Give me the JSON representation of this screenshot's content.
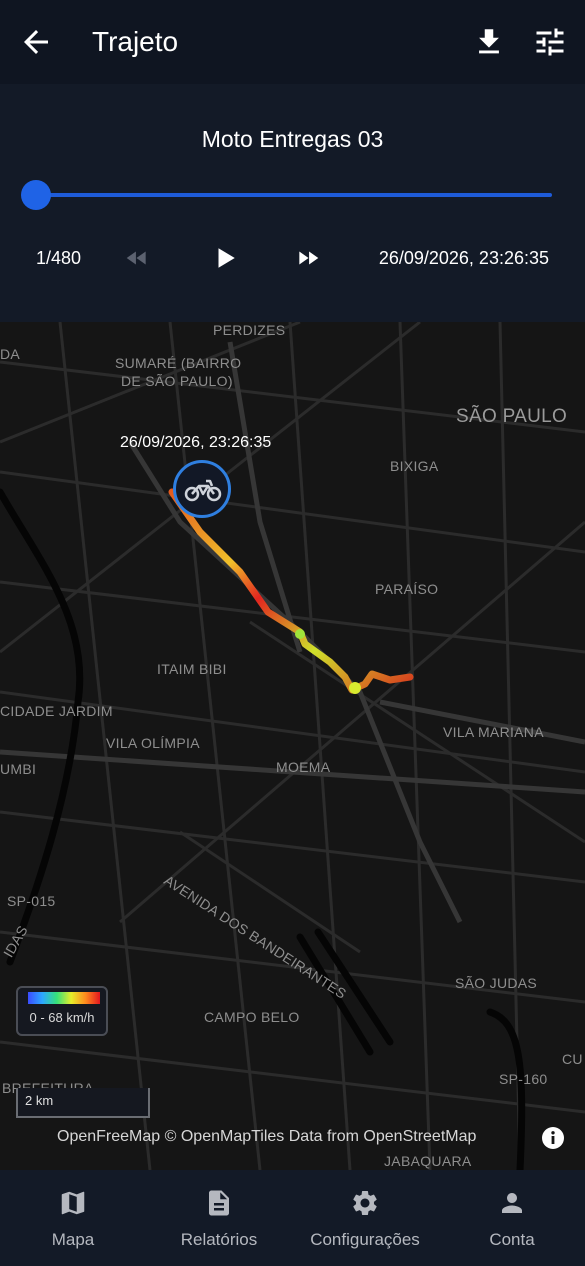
{
  "appbar": {
    "title": "Trajeto"
  },
  "player": {
    "device_name": "Moto Entregas 03",
    "counter": "1/480",
    "timestamp": "26/09/2026, 23:26:35",
    "progress": 0.0
  },
  "map": {
    "labels": {
      "perdizes": "PERDIZES",
      "da": "DA",
      "sumare1": "SUMARÉ (BAIRRO",
      "sumare2": "DE SÃO PAULO)",
      "sao_paulo": "SÃO PAULO",
      "bixiga": "BIXIGA",
      "paraiso": "PARAÍSO",
      "itaim": "ITAIM BIBI",
      "cidade_jardim": "CIDADE JARDIM",
      "vila_olimpia": "VILA OLÍMPIA",
      "vila_mariana": "VILA MARIANA",
      "umbi": "UMBI",
      "moema": "MOEMA",
      "avenida": "AVENIDA DOS BANDEIRANTES",
      "sp015": "SP-015",
      "idas": "IDAS",
      "sao_judas": "SÃO JUDAS",
      "campo_belo": "CAMPO BELO",
      "sp160": "SP-160",
      "bre": "BREFEITURA",
      "cu": "CU",
      "jabaquara": "JABAQUARA"
    },
    "marker_time": "26/09/2026, 23:26:35",
    "legend": "0 - 68 km/h",
    "scale": "2 km",
    "attribution": "OpenFreeMap © OpenMapTiles Data from OpenStreetMap"
  },
  "nav": [
    {
      "label": "Mapa",
      "icon": "map-icon"
    },
    {
      "label": "Relatórios",
      "icon": "document-icon"
    },
    {
      "label": "Configurações",
      "icon": "gear-icon"
    },
    {
      "label": "Conta",
      "icon": "person-icon"
    }
  ],
  "colors": {
    "accent": "#1f63e6",
    "background": "#0f1521",
    "panel": "#131a27"
  }
}
